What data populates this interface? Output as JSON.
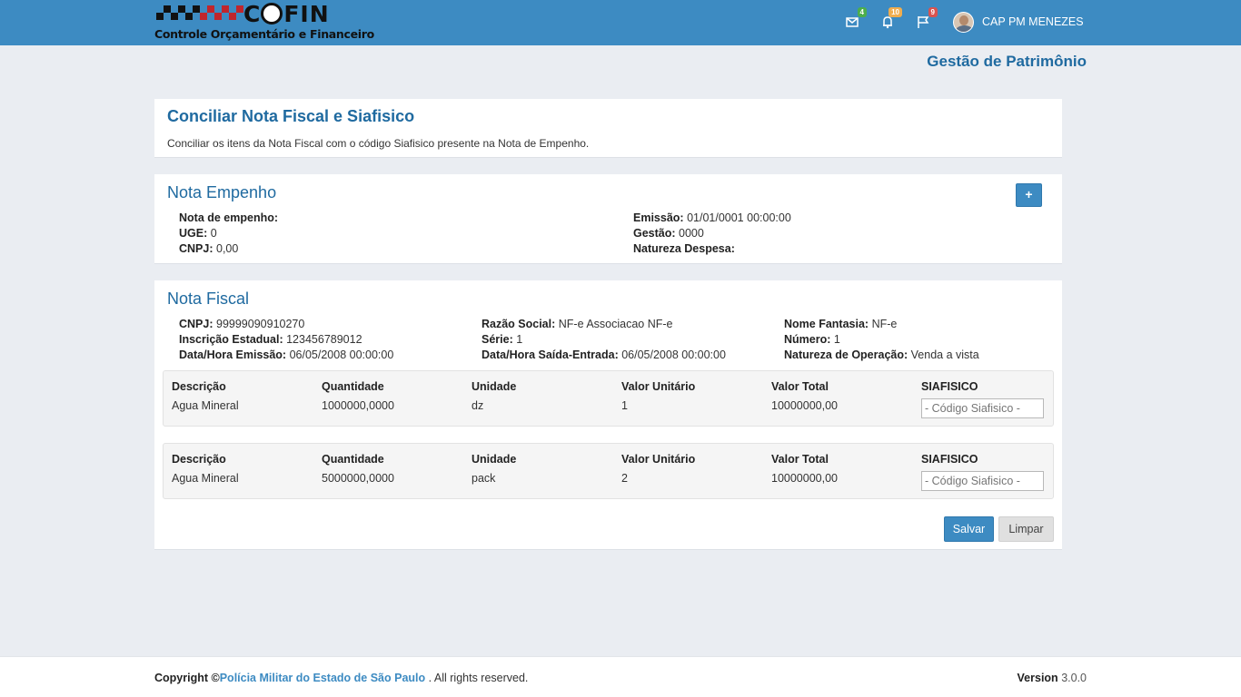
{
  "header": {
    "logo_brand": "COFIN",
    "logo_subtitle": "Controle Orçamentário e Financeiro",
    "messages_badge": "4",
    "messages_badge_color": "#4cae4c",
    "notifications_badge": "10",
    "notifications_badge_color": "#f0ad4e",
    "flags_badge": "9",
    "flags_badge_color": "#d9534f",
    "user_name": "CAP PM MENEZES",
    "bar_color": "#3d8bc2"
  },
  "module_title": "Gestão de Patrimônio",
  "page": {
    "title": "Conciliar Nota Fiscal e Siafisico",
    "description": "Conciliar os itens da Nota Fiscal com o código Siafisico presente na Nota de Empenho."
  },
  "nota_empenho": {
    "title": "Nota Empenho",
    "add_button": "+",
    "labels": {
      "nota": "Nota de empenho:",
      "uge": "UGE:",
      "cnpj": "CNPJ:",
      "emissao": "Emissão:",
      "gestao": "Gestão:",
      "natureza": "Natureza Despesa:"
    },
    "values": {
      "nota": "",
      "uge": "0",
      "cnpj": "0,00",
      "emissao": "01/01/0001 00:00:00",
      "gestao": "0000",
      "natureza": ""
    }
  },
  "nota_fiscal": {
    "title": "Nota Fiscal",
    "labels": {
      "cnpj": "CNPJ:",
      "inscricao": "Inscrição Estadual:",
      "emissao": "Data/Hora Emissão:",
      "razao": "Razão Social:",
      "serie": "Série:",
      "saida": "Data/Hora Saída-Entrada:",
      "fantasia": "Nome Fantasia:",
      "numero": "Número:",
      "natureza": "Natureza de Operação:"
    },
    "values": {
      "cnpj": "99999090910270",
      "inscricao": "123456789012",
      "emissao": "06/05/2008 00:00:00",
      "razao": "NF-e Associacao NF-e",
      "serie": "1",
      "saida": "06/05/2008 00:00:00",
      "fantasia": "NF-e",
      "numero": "1",
      "natureza": "Venda a vista"
    },
    "columns": {
      "descricao": "Descrição",
      "quantidade": "Quantidade",
      "unidade": "Unidade",
      "valor_unitario": "Valor Unitário",
      "valor_total": "Valor Total",
      "siafisico": "SIAFISICO"
    },
    "items": [
      {
        "descricao": "Agua Mineral",
        "quantidade": "1000000,0000",
        "unidade": "dz",
        "valor_unitario": "1",
        "valor_total": "10000000,00",
        "siafisico_value": "",
        "siafisico_placeholder": "- Código Siafisico -"
      },
      {
        "descricao": "Agua Mineral",
        "quantidade": "5000000,0000",
        "unidade": "pack",
        "valor_unitario": "2",
        "valor_total": "10000000,00",
        "siafisico_value": "",
        "siafisico_placeholder": "- Código Siafisico -"
      }
    ],
    "save_button": "Salvar",
    "clear_button": "Limpar"
  },
  "footer": {
    "copyright_label": "Copyright ©",
    "organization": "Polícia Militar do Estado de São Paulo",
    "rights": " . All rights reserved.",
    "version_label": "Version",
    "version_value": "3.0.0"
  }
}
